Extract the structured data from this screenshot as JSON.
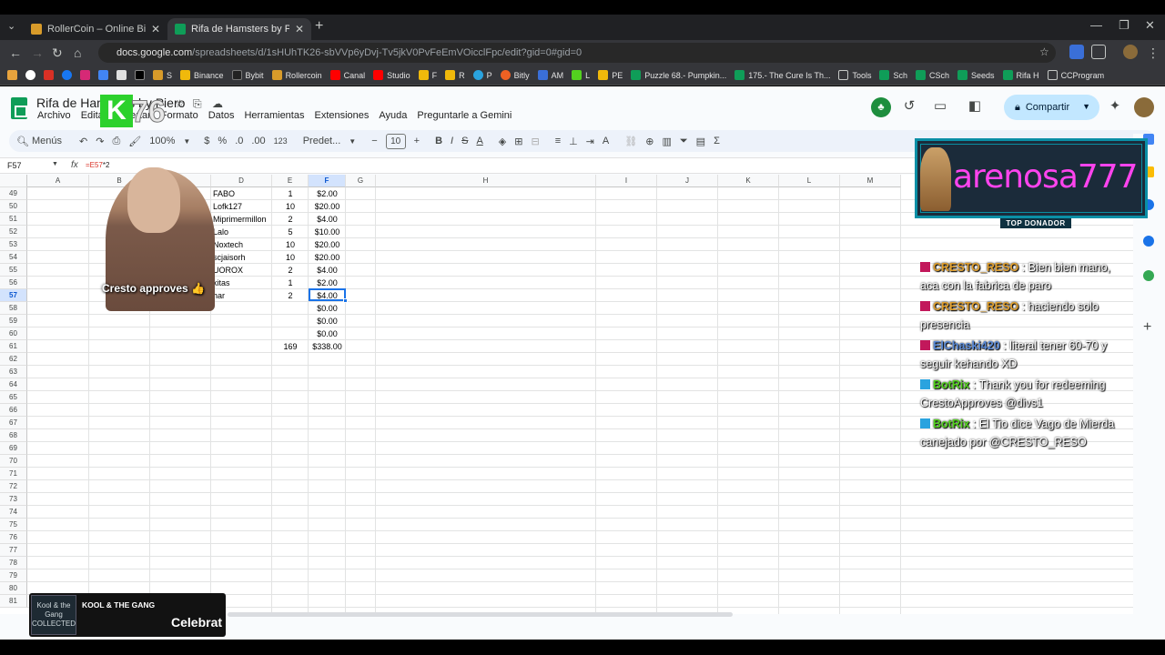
{
  "browser": {
    "tabs": [
      {
        "title": "RollerCoin – Online Bitcoin Mi",
        "active": false
      },
      {
        "title": "Rifa de Hamsters by Piero - Ho",
        "active": true
      }
    ],
    "url_domain": "docs.google.com",
    "url_path": "/spreadsheets/d/1sHUhTK26-sbVVp6yDvj-Tv5jkV0PvFeEmVOicclFpc/edit?gid=0#gid=0",
    "bookmarks": [
      "S",
      "Binance",
      "Bybit",
      "Rollercoin",
      "Canal",
      "Studio",
      "F",
      "R",
      "P",
      "Bitly",
      "AM",
      "L",
      "PE",
      "Puzzle 68.- Pumpkin...",
      "175.- The Cure Is Th...",
      "Tools",
      "Sch",
      "CSch",
      "Seeds",
      "Rifa H",
      "CCProgram"
    ]
  },
  "sheets": {
    "doc_title": "Rifa de Hamsters by Piero",
    "menus": [
      "Archivo",
      "Editar",
      "Insertar",
      "Formato",
      "Datos",
      "Herramientas",
      "Extensiones",
      "Ayuda",
      "Preguntarle a Gemini"
    ],
    "share_label": "Compartir",
    "toolbar": {
      "menus_label": "Menús",
      "zoom": "100%",
      "currency": "$",
      "percent": "%",
      "dec_less": ".0",
      "dec_more": ".00",
      "num_format": "123",
      "font": "Predet...",
      "font_size": "10"
    },
    "namebox": "F57",
    "formula_ref": "=E57",
    "formula_rest": "*2",
    "columns": [
      "A",
      "B",
      "C",
      "D",
      "E",
      "F",
      "G",
      "H",
      "I",
      "J",
      "K",
      "L",
      "M"
    ],
    "row_numbers": [
      "49",
      "50",
      "51",
      "52",
      "53",
      "54",
      "55",
      "56",
      "57",
      "58",
      "59",
      "60",
      "61",
      "62",
      "63",
      "64",
      "65",
      "66",
      "67",
      "68",
      "69",
      "70",
      "71",
      "72",
      "73",
      "74",
      "75",
      "76",
      "77",
      "78",
      "79",
      "80",
      "81"
    ],
    "rows": [
      {
        "d": "FABO",
        "e": "1",
        "f": "$2.00"
      },
      {
        "d": "Lofk127",
        "e": "10",
        "f": "$20.00"
      },
      {
        "d": "Miprimermillon",
        "e": "2",
        "f": "$4.00"
      },
      {
        "d": "Lalo",
        "e": "5",
        "f": "$10.00"
      },
      {
        "d": "Noxtech",
        "e": "10",
        "f": "$20.00"
      },
      {
        "d": "scjaisorh",
        "e": "10",
        "f": "$20.00"
      },
      {
        "d": "UOROX",
        "e": "2",
        "f": "$4.00"
      },
      {
        "d": "kitas",
        "e": "1",
        "f": "$2.00"
      },
      {
        "d": "har",
        "e": "2",
        "f": "$4.00"
      },
      {
        "d": "",
        "e": "",
        "f": "$0.00"
      },
      {
        "d": "",
        "e": "",
        "f": "$0.00"
      },
      {
        "d": "",
        "e": "",
        "f": "$0.00"
      },
      {
        "d": "",
        "e": "169",
        "f": "$338.00"
      }
    ]
  },
  "overlays": {
    "k_number": "76",
    "k_letter": "K",
    "cresto_caption": "Cresto approves 👍",
    "top_donor_name": "arenosa777",
    "top_donor_tag": "TOP DONADOR",
    "chat": [
      {
        "user": "CRESTO_RESO",
        "user_color": "#e0a030",
        "text": ": Bien bien mano, aca con la fabrica de paro"
      },
      {
        "user": "CRESTO_RESO",
        "user_color": "#e0a030",
        "text": ": haciendo solo presencia"
      },
      {
        "user": "ElChaski420",
        "user_color": "#5b8bd8",
        "text": ": literal tener 60-70 y seguir kehando XD"
      },
      {
        "user": "BotRix",
        "user_color": "#53d11f",
        "text": ": Thank you for redeeming CrestoApproves @divs1"
      },
      {
        "user": "BotRix",
        "user_color": "#53d11f",
        "text": ": El Tio dice Vago de Mierda canejado por @CRESTO_RESO"
      }
    ],
    "music_artist": "KOOL & THE GANG",
    "music_track": "Celebrat",
    "music_cover": "Kool & the Gang COLLECTED"
  }
}
